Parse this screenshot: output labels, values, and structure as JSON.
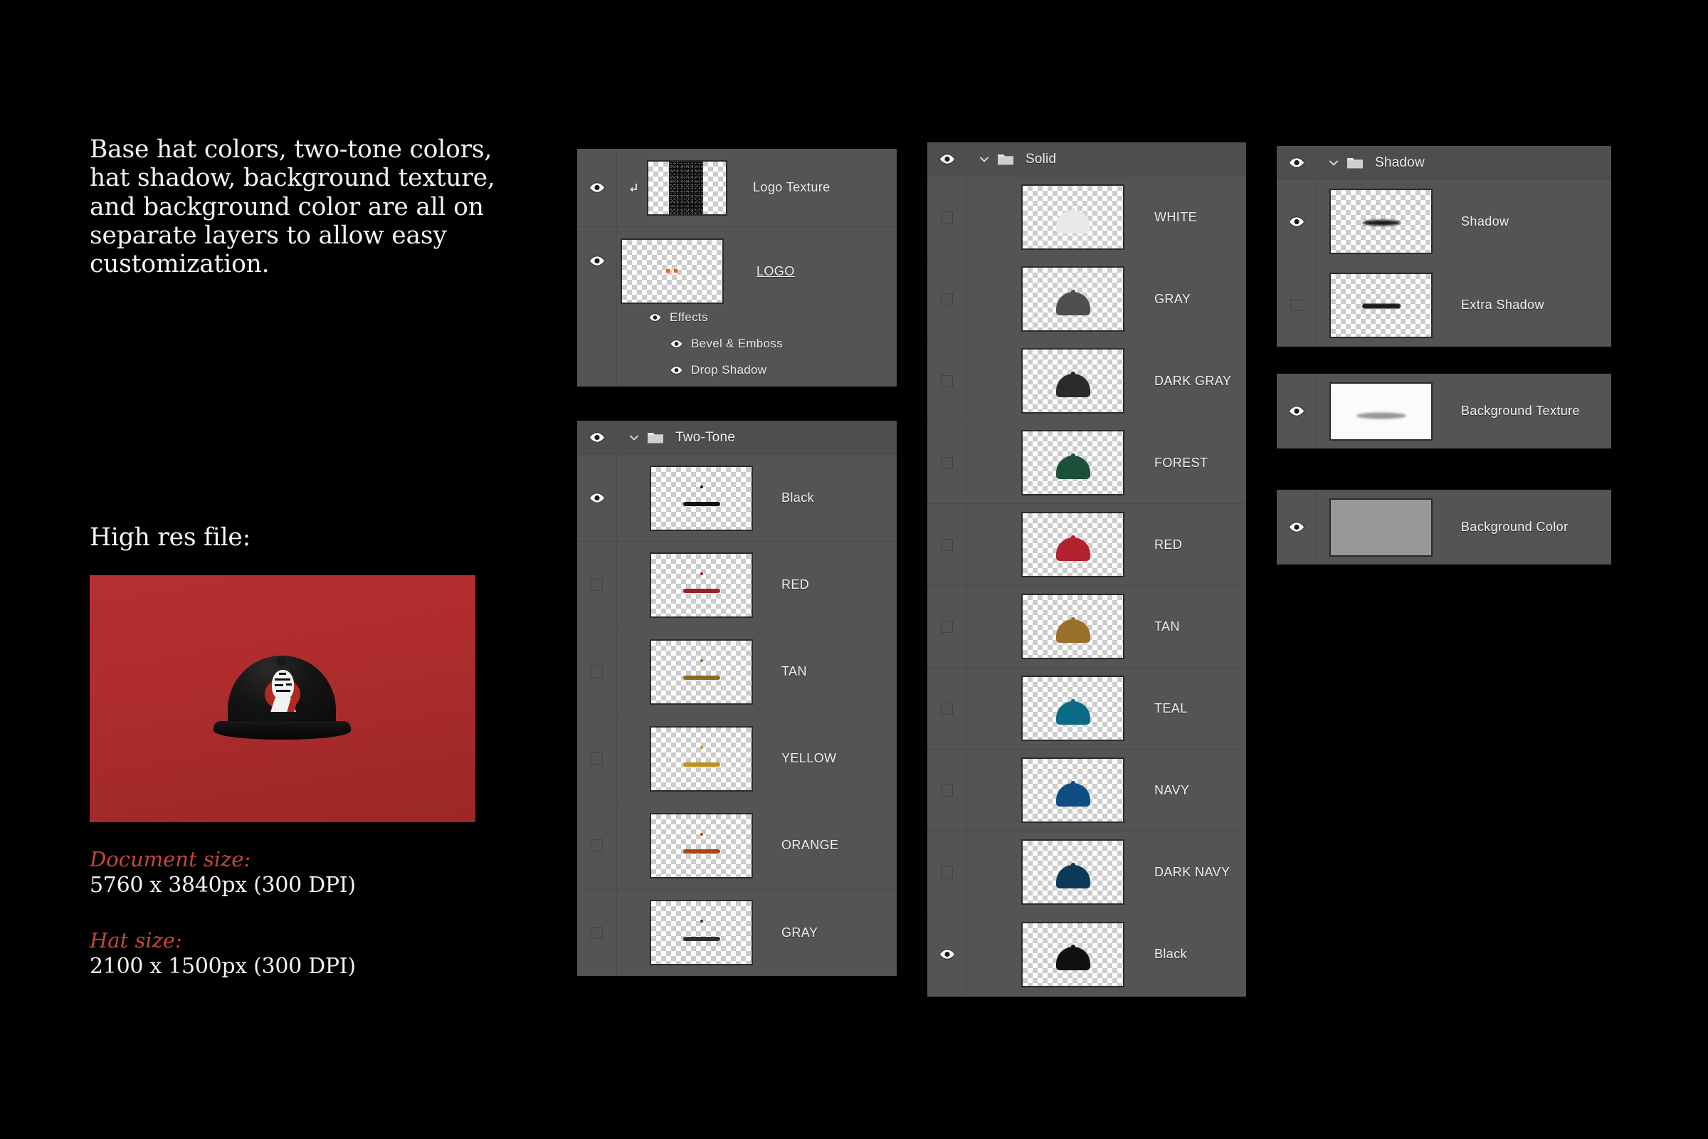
{
  "intro": {
    "paragraph": "Base hat colors, two-tone colors, hat shadow, background texture, and background color are all on separate layers to allow easy customization."
  },
  "highres": {
    "heading": "High res file:",
    "document_size_label": "Document size:",
    "document_size_value": "5760 x 3840px (300 DPI)",
    "hat_size_label": "Hat size:",
    "hat_size_value": "2100 x 1500px (300 DPI)",
    "preview_background_color": "#b02c2c",
    "preview_hat_color": "#0d0d0d"
  },
  "panels": {
    "logo": {
      "rows": [
        {
          "name": "Logo Texture",
          "visible": true,
          "clipped": true,
          "thumb": "noise-strip"
        },
        {
          "name": "LOGO",
          "visible": true,
          "underline": true,
          "thumb": "logo-dots"
        }
      ],
      "effects": {
        "label": "Effects",
        "items": [
          "Bevel & Emboss",
          "Drop Shadow"
        ]
      }
    },
    "two_tone": {
      "group_label": "Two-Tone",
      "group_visible": true,
      "layers": [
        {
          "name": "Black",
          "visible": true,
          "color": "#111111"
        },
        {
          "name": "RED",
          "visible": false,
          "color": "#9e2020"
        },
        {
          "name": "TAN",
          "visible": false,
          "color": "#8b6a24"
        },
        {
          "name": "YELLOW",
          "visible": false,
          "color": "#c3901b"
        },
        {
          "name": "ORANGE",
          "visible": false,
          "color": "#b1430f"
        },
        {
          "name": "GRAY",
          "visible": false,
          "color": "#303030"
        }
      ]
    },
    "solid": {
      "group_label": "Solid",
      "group_visible": true,
      "layers": [
        {
          "name": "WHITE",
          "visible": false,
          "color": "#e9e9e9"
        },
        {
          "name": "GRAY",
          "visible": false,
          "color": "#4e4e4e"
        },
        {
          "name": "DARK GRAY",
          "visible": false,
          "color": "#2b2b2b"
        },
        {
          "name": "FOREST",
          "visible": false,
          "color": "#1d5039"
        },
        {
          "name": "RED",
          "visible": false,
          "color": "#b3202e"
        },
        {
          "name": "TAN",
          "visible": false,
          "color": "#9a7029"
        },
        {
          "name": "TEAL",
          "visible": false,
          "color": "#0b6b86"
        },
        {
          "name": "NAVY",
          "visible": false,
          "color": "#0f4d83"
        },
        {
          "name": "DARK NAVY",
          "visible": false,
          "color": "#0d3a59"
        },
        {
          "name": "Black",
          "visible": true,
          "color": "#111111"
        }
      ]
    },
    "shadow": {
      "group_label": "Shadow",
      "group_visible": true,
      "layers": [
        {
          "name": "Shadow",
          "visible": true,
          "style": "soft"
        },
        {
          "name": "Extra Shadow",
          "visible": false,
          "style": "hard"
        }
      ]
    },
    "background_texture": {
      "name": "Background Texture",
      "visible": true,
      "thumb_color": "#fbfbfb"
    },
    "background_color": {
      "name": "Background Color",
      "visible": true,
      "thumb_color": "#989898"
    }
  }
}
